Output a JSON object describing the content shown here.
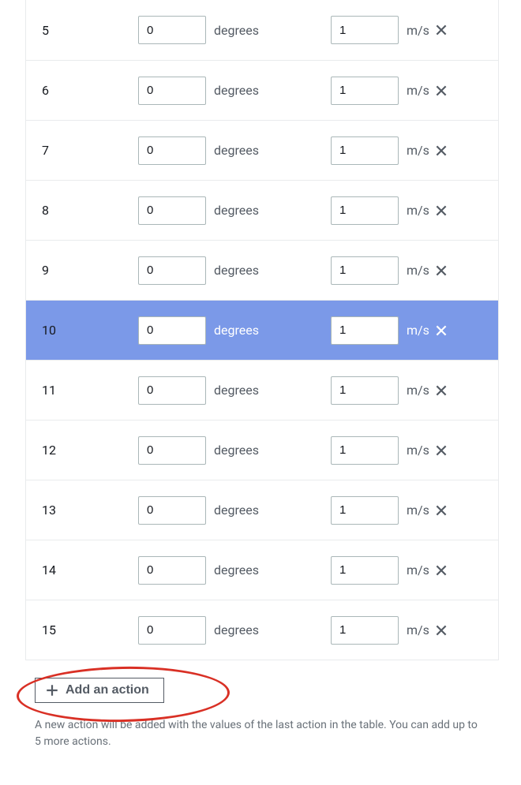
{
  "actions_table": {
    "rows": [
      {
        "num": "5",
        "angle": "0",
        "angle_unit": "degrees",
        "speed": "1",
        "speed_unit": "m/s",
        "selected": false
      },
      {
        "num": "6",
        "angle": "0",
        "angle_unit": "degrees",
        "speed": "1",
        "speed_unit": "m/s",
        "selected": false
      },
      {
        "num": "7",
        "angle": "0",
        "angle_unit": "degrees",
        "speed": "1",
        "speed_unit": "m/s",
        "selected": false
      },
      {
        "num": "8",
        "angle": "0",
        "angle_unit": "degrees",
        "speed": "1",
        "speed_unit": "m/s",
        "selected": false
      },
      {
        "num": "9",
        "angle": "0",
        "angle_unit": "degrees",
        "speed": "1",
        "speed_unit": "m/s",
        "selected": false
      },
      {
        "num": "10",
        "angle": "0",
        "angle_unit": "degrees",
        "speed": "1",
        "speed_unit": "m/s",
        "selected": true
      },
      {
        "num": "11",
        "angle": "0",
        "angle_unit": "degrees",
        "speed": "1",
        "speed_unit": "m/s",
        "selected": false
      },
      {
        "num": "12",
        "angle": "0",
        "angle_unit": "degrees",
        "speed": "1",
        "speed_unit": "m/s",
        "selected": false
      },
      {
        "num": "13",
        "angle": "0",
        "angle_unit": "degrees",
        "speed": "1",
        "speed_unit": "m/s",
        "selected": false
      },
      {
        "num": "14",
        "angle": "0",
        "angle_unit": "degrees",
        "speed": "1",
        "speed_unit": "m/s",
        "selected": false
      },
      {
        "num": "15",
        "angle": "0",
        "angle_unit": "degrees",
        "speed": "1",
        "speed_unit": "m/s",
        "selected": false
      }
    ]
  },
  "footer": {
    "add_button_label": "Add an action",
    "helper_text": "A new action will be added with the values of the last action in the table. You can add up to 5 more actions."
  }
}
